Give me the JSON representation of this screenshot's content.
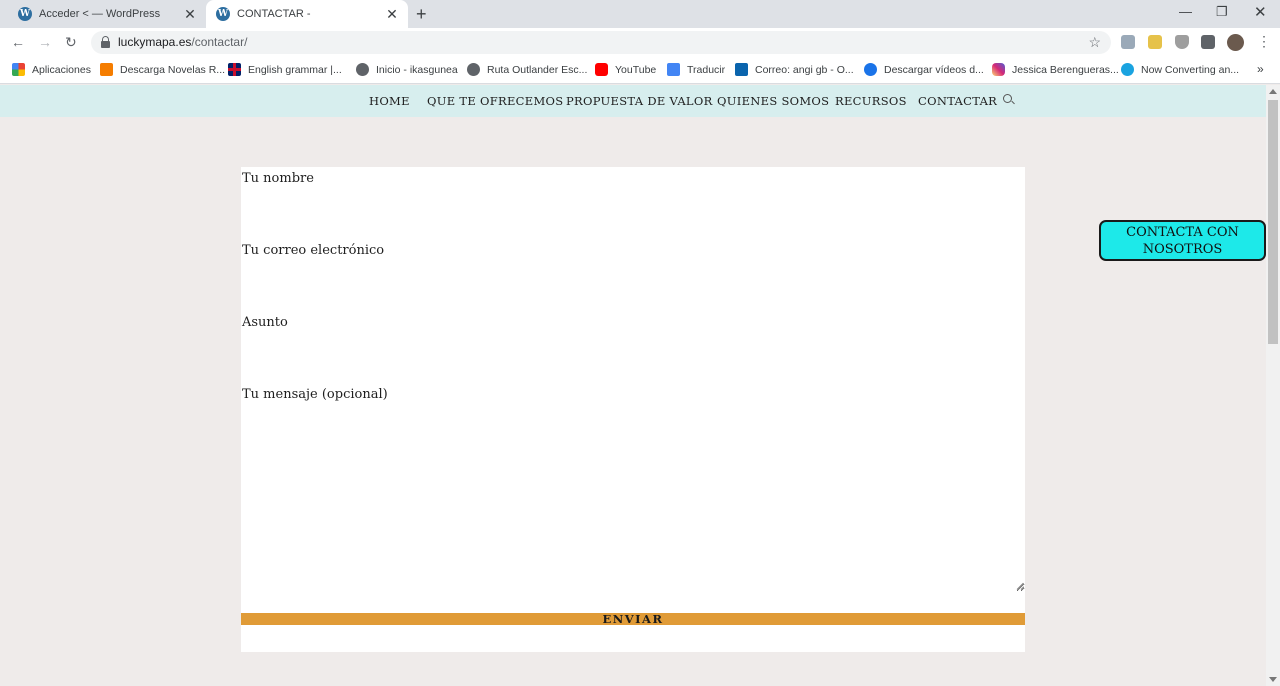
{
  "browser": {
    "tabs": [
      {
        "title": "Acceder < — WordPress",
        "favicon": "wordpress-icon"
      },
      {
        "title": "CONTACTAR -",
        "favicon": "wordpress-icon"
      }
    ],
    "url_domain": "luckymapa.es",
    "url_path": "/contactar/",
    "bookmarks": [
      {
        "label": "Aplicaciones",
        "icon": "apps-grid-icon"
      },
      {
        "label": "Descarga Novelas R...",
        "icon": "blogger-icon"
      },
      {
        "label": "English grammar |...",
        "icon": "uk-flag-icon"
      },
      {
        "label": "Inicio - ikasgunea",
        "icon": "globe-icon"
      },
      {
        "label": "Ruta Outlander Esc...",
        "icon": "globe-icon"
      },
      {
        "label": "YouTube",
        "icon": "youtube-icon"
      },
      {
        "label": "Traducir",
        "icon": "translate-icon"
      },
      {
        "label": "Correo: angi gb - O...",
        "icon": "outlook-icon"
      },
      {
        "label": "Descargar vídeos d...",
        "icon": "download-icon"
      },
      {
        "label": "Jessica Berengueras...",
        "icon": "instagram-icon"
      },
      {
        "label": "Now Converting an...",
        "icon": "convert-icon"
      }
    ]
  },
  "site": {
    "nav": [
      "HOME",
      "QUE TE OFRECEMOS",
      "PROPUESTA DE VALOR",
      "QUIENES SOMOS",
      "RECURSOS",
      "CONTACTAR"
    ],
    "form": {
      "name_label": "Tu nombre",
      "email_label": "Tu correo electrónico",
      "subject_label": "Asunto",
      "message_label": "Tu mensaje (opcional)",
      "submit_label": "ENVIAR"
    },
    "cta_label": "CONTACTA CON NOSOTROS"
  },
  "colors": {
    "nav_bg": "#d7eeee",
    "page_bg": "#efebea",
    "submit_bg": "#e09b37",
    "cta_bg": "#1de9e9"
  }
}
